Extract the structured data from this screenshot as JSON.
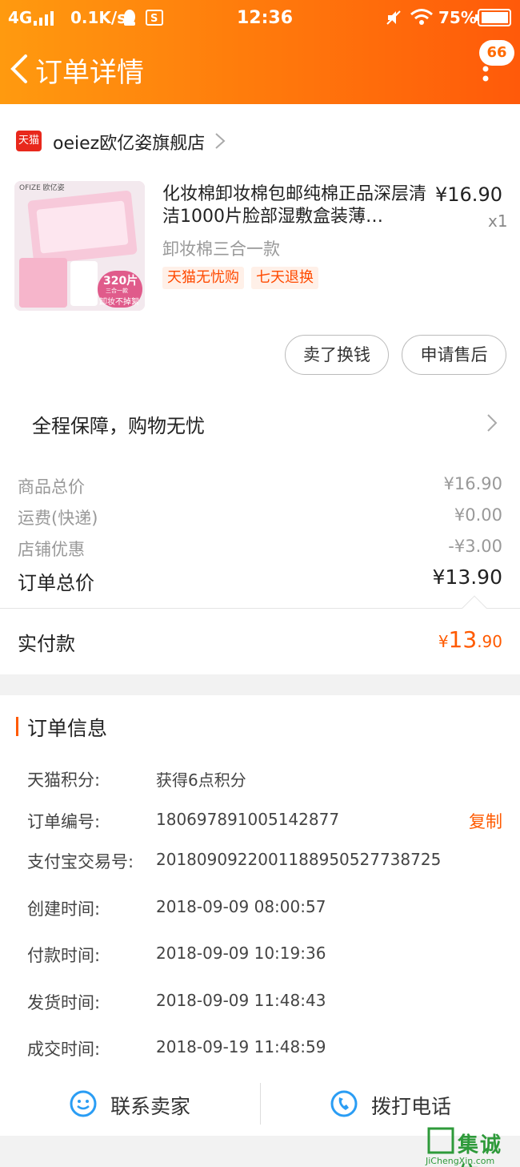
{
  "status_bar": {
    "network": "4G",
    "speed": "0.1K/s",
    "time": "12:36",
    "battery": "75%"
  },
  "header": {
    "title": "订单详情",
    "badge": "66"
  },
  "store": {
    "badge": "天猫",
    "name": "oeiez欧亿姿旗舰店"
  },
  "product": {
    "title": "化妆棉卸妆棉包邮纯棉正品深层清洁1000片脸部湿敷盒装薄…",
    "price": "¥16.90",
    "quantity": "x1",
    "spec": "卸妆棉三合一款",
    "tags": [
      "天猫无忧购",
      "七天退换"
    ],
    "image": {
      "brand": "OFIZE 欧亿姿",
      "count_label": "320片",
      "line1": "三合一款",
      "line2": "卸妆不掉絮"
    }
  },
  "actions": {
    "sell": "卖了换钱",
    "after_sale": "申请售后"
  },
  "guarantee": "全程保障，购物无忧",
  "fees": [
    {
      "label": "商品总价",
      "value": "¥16.90"
    },
    {
      "label": "运费(快递)",
      "value": "¥0.00"
    },
    {
      "label": "店铺优惠",
      "value": "-¥3.00"
    }
  ],
  "total": {
    "label": "订单总价",
    "value": "¥13.90"
  },
  "paid": {
    "label": "实付款",
    "symbol": "¥",
    "integer": "13",
    "decimal": ".90"
  },
  "order_info": {
    "title": "订单信息",
    "rows": [
      {
        "label": "天猫积分:",
        "value": "获得6点积分"
      },
      {
        "label": "订单编号:",
        "value": "180697891005142877"
      },
      {
        "label": "支付宝交易号:",
        "value": "2018090922001188950527738725"
      },
      {
        "label": "创建时间:",
        "value": "2018-09-09 08:00:57"
      },
      {
        "label": "付款时间:",
        "value": "2018-09-09 10:19:36"
      },
      {
        "label": "发货时间:",
        "value": "2018-09-09 11:48:43"
      },
      {
        "label": "成交时间:",
        "value": "2018-09-19 11:48:59"
      }
    ],
    "copy": "复制"
  },
  "bottom_actions": {
    "contact": "联系卖家",
    "call": "拨打电话"
  },
  "watermark": {
    "text": "集诚信",
    "url": "JiChengXin.com"
  },
  "colors": {
    "accent": "#ff5a00",
    "header_start": "#ff9a0f",
    "header_end": "#ff5a0a"
  }
}
